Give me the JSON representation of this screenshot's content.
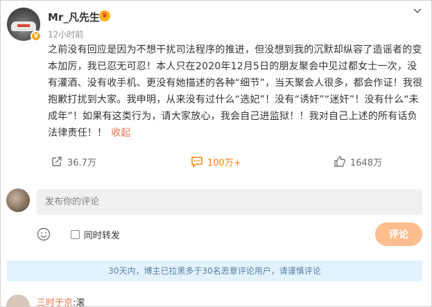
{
  "post": {
    "username": "Mr_凡先生",
    "verified_badge": "V",
    "vip_badge_icon": "crown-icon",
    "time": "12小时前",
    "body": "之前没有回应是因为不想干扰司法程序的推进，但没想到我的沉默却纵容了造谣者的变本加厉，我已忍无可忍！本人只在2020年12月5日的朋友聚会中见过都女士一次，没有灌酒、没有收手机、更没有她描述的各种“细节”，当天聚会人很多，都会作证！我很抱歉打扰到大家。我申明，从来没有过什么“选妃”！没有“诱奸”“迷奸”！没有什么“未成年”！如果有这类行为，请大家放心，我会自己进监狱！！我对自己上述的所有话负法律责任！！",
    "collapse_label": "收起"
  },
  "actions": {
    "share_count": "36.7万",
    "comment_count": "100万+",
    "like_count": "1648万"
  },
  "comment_box": {
    "placeholder": "发布你的评论",
    "repost_label": "同时转发",
    "submit_label": "评论"
  },
  "notice": "30天内，博主已拉黑多于30名恶意评论用户，请谨慎评论",
  "first_comment": {
    "name": "三时于京",
    "text": ":滚"
  },
  "colors": {
    "accent": "#ff8200",
    "link": "#eb7350",
    "submit_disabled": "#fdbe8f",
    "notice_bg": "#e3f3fd"
  }
}
